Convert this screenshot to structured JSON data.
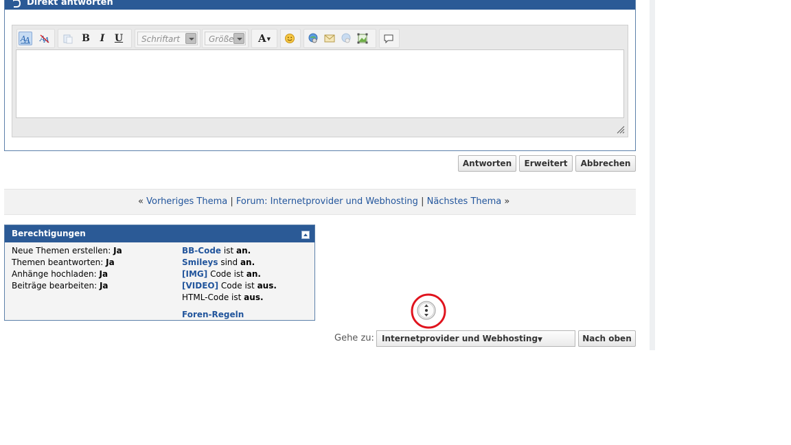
{
  "quick_reply": {
    "title": "Direkt antworten",
    "toolbar": {
      "font_placeholder": "Schriftart",
      "size_placeholder": "Größe",
      "bold": "B",
      "italic": "I",
      "underline": "U",
      "font_color": "A"
    }
  },
  "buttons": {
    "reply": "Antworten",
    "advanced": "Erweitert",
    "cancel": "Abbrechen"
  },
  "thread_nav": {
    "prev_quote": "«",
    "prev": "Vorheriges Thema",
    "sep1": "|",
    "forum": "Forum: Internetprovider und Webhosting",
    "sep2": "|",
    "next": "Nächstes Thema",
    "next_quote": "»"
  },
  "permissions": {
    "title": "Berechtigungen",
    "left": [
      {
        "label": "Neue Themen erstellen:",
        "value": "Ja"
      },
      {
        "label": "Themen beantworten:",
        "value": "Ja"
      },
      {
        "label": "Anhänge hochladen:",
        "value": "Ja"
      },
      {
        "label": "Beiträge bearbeiten:",
        "value": "Ja"
      }
    ],
    "right": [
      {
        "link": "BB-Code",
        "text": "ist",
        "state": "an",
        "dot": "."
      },
      {
        "link": "Smileys",
        "text": "sind",
        "state": "an",
        "dot": "."
      },
      {
        "link": "[IMG]",
        "text": "Code ist",
        "state": "an",
        "dot": "."
      },
      {
        "link": "[VIDEO]",
        "text": "Code ist",
        "state": "aus",
        "dot": "."
      },
      {
        "plain": "HTML-Code ist",
        "state": "aus",
        "dot": "."
      }
    ],
    "rules_link": "Foren-Regeln"
  },
  "goto": {
    "label": "Gehe zu:",
    "selected": "Internetprovider und Webhosting",
    "top_button": "Nach oben"
  },
  "colors": {
    "header_blue": "#2b5a96",
    "link_blue": "#22559c",
    "highlight_red": "#e0141e"
  }
}
